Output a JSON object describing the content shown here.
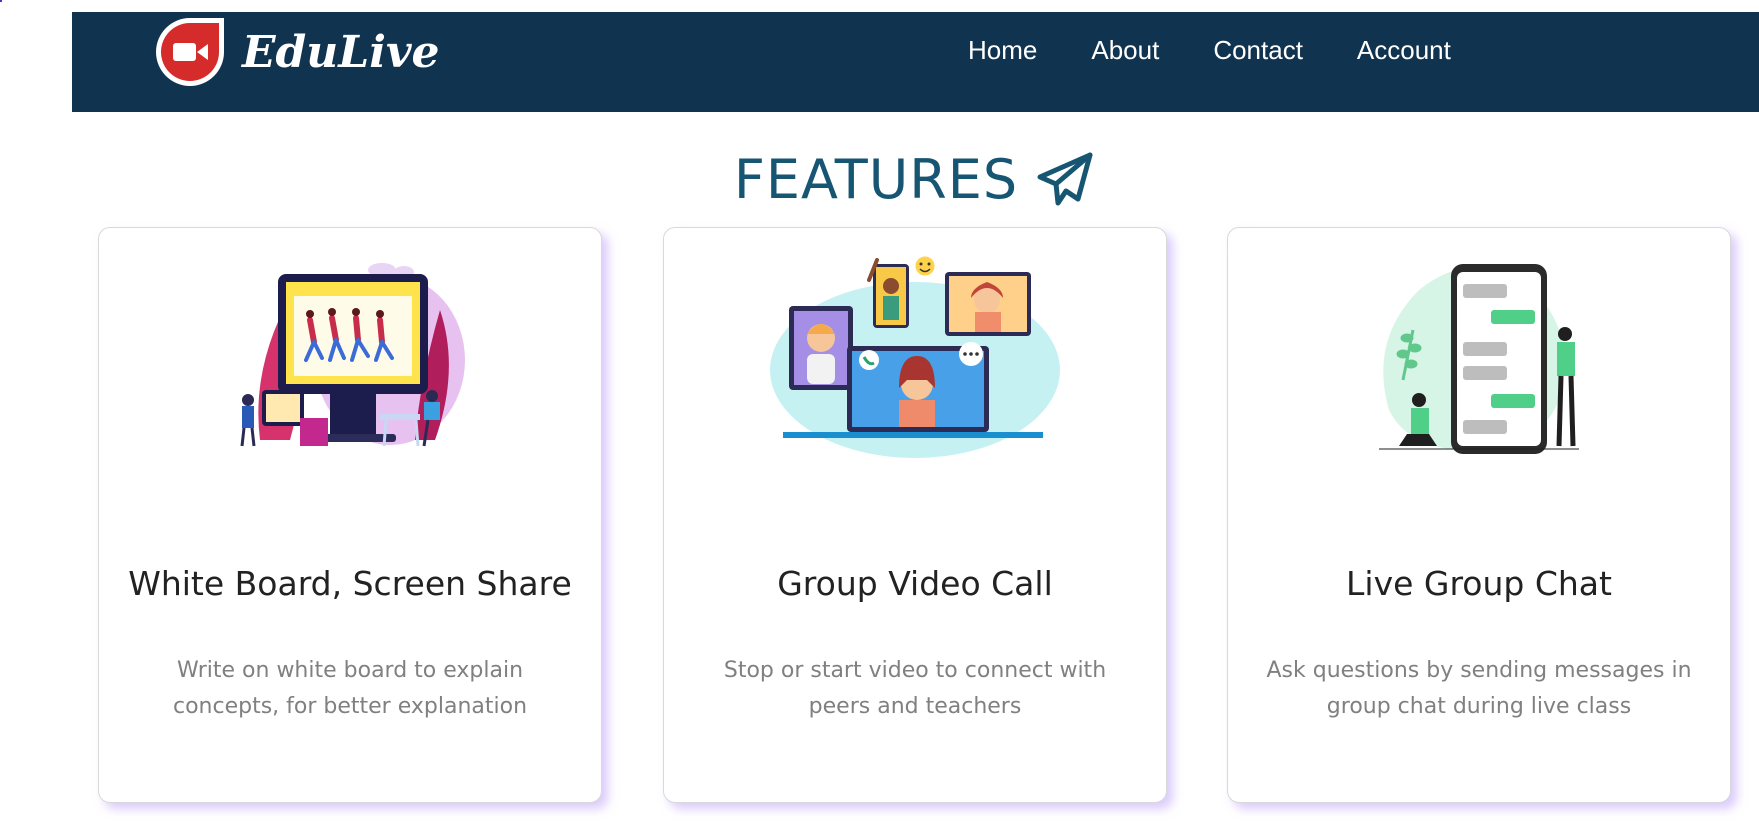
{
  "navbar": {
    "brand": "EduLive",
    "links": [
      "Home",
      "About",
      "Contact",
      "Account"
    ]
  },
  "features": {
    "heading": "FEATURES",
    "cards": [
      {
        "title": "White Board, Screen Share",
        "description": "Write on white board to explain concepts, for better explanation"
      },
      {
        "title": "Group Video Call",
        "description": "Stop or start video to connect with peers and teachers"
      },
      {
        "title": "Live Group Chat",
        "description": "Ask questions by sending messages in group chat during live class"
      }
    ]
  },
  "colors": {
    "navbar_bg": "#10334f",
    "heading": "#175673",
    "logo_red": "#d52b2b",
    "card_shadow": "#bea0fa"
  },
  "icons": [
    "video-camera-logo-icon",
    "paper-plane-icon"
  ]
}
